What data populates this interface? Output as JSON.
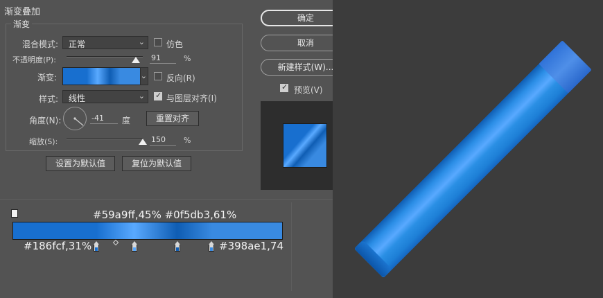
{
  "dialog": {
    "section_title": "渐变叠加",
    "group_title": "渐变",
    "blend_mode": {
      "label": "混合模式:",
      "value": "正常"
    },
    "dither": {
      "label": "仿色",
      "checked": false
    },
    "opacity": {
      "label": "不透明度(P):",
      "value": "91",
      "unit": "%",
      "level": 0.91
    },
    "gradient": {
      "label": "渐变:"
    },
    "reverse": {
      "label": "反向(R)",
      "checked": false
    },
    "style": {
      "label": "样式:",
      "value": "线性"
    },
    "align": {
      "label": "与图层对齐(I)",
      "checked": true
    },
    "angle": {
      "label": "角度(N):",
      "value": "-41",
      "unit": "度",
      "reset_label": "重置对齐"
    },
    "scale": {
      "label": "缩放(S):",
      "value": "150",
      "unit": "%",
      "level": 1.0
    },
    "set_default_label": "设置为默认值",
    "reset_default_label": "复位为默认值"
  },
  "side_buttons": {
    "ok_label": "确定",
    "cancel_label": "取消",
    "new_style_label": "新建样式(W)...",
    "preview": {
      "label": "预览(V)",
      "checked": true
    }
  },
  "gradient_editor": {
    "stops_top": "#59a9ff,45%  #0f5db3,61%",
    "stop_left": "#186fcf,31%",
    "stop_right": "#398ae1,74",
    "stops": [
      {
        "color": "#186fcf",
        "position": 31
      },
      {
        "color": "#59a9ff",
        "position": 45
      },
      {
        "color": "#0f5db3",
        "position": 61
      },
      {
        "color": "#398ae1",
        "position": 74
      }
    ]
  },
  "colors": {
    "accent_blue": "#1b6fd1",
    "tube_light": "#59a9ff",
    "tube_dark": "#0f5db3"
  }
}
